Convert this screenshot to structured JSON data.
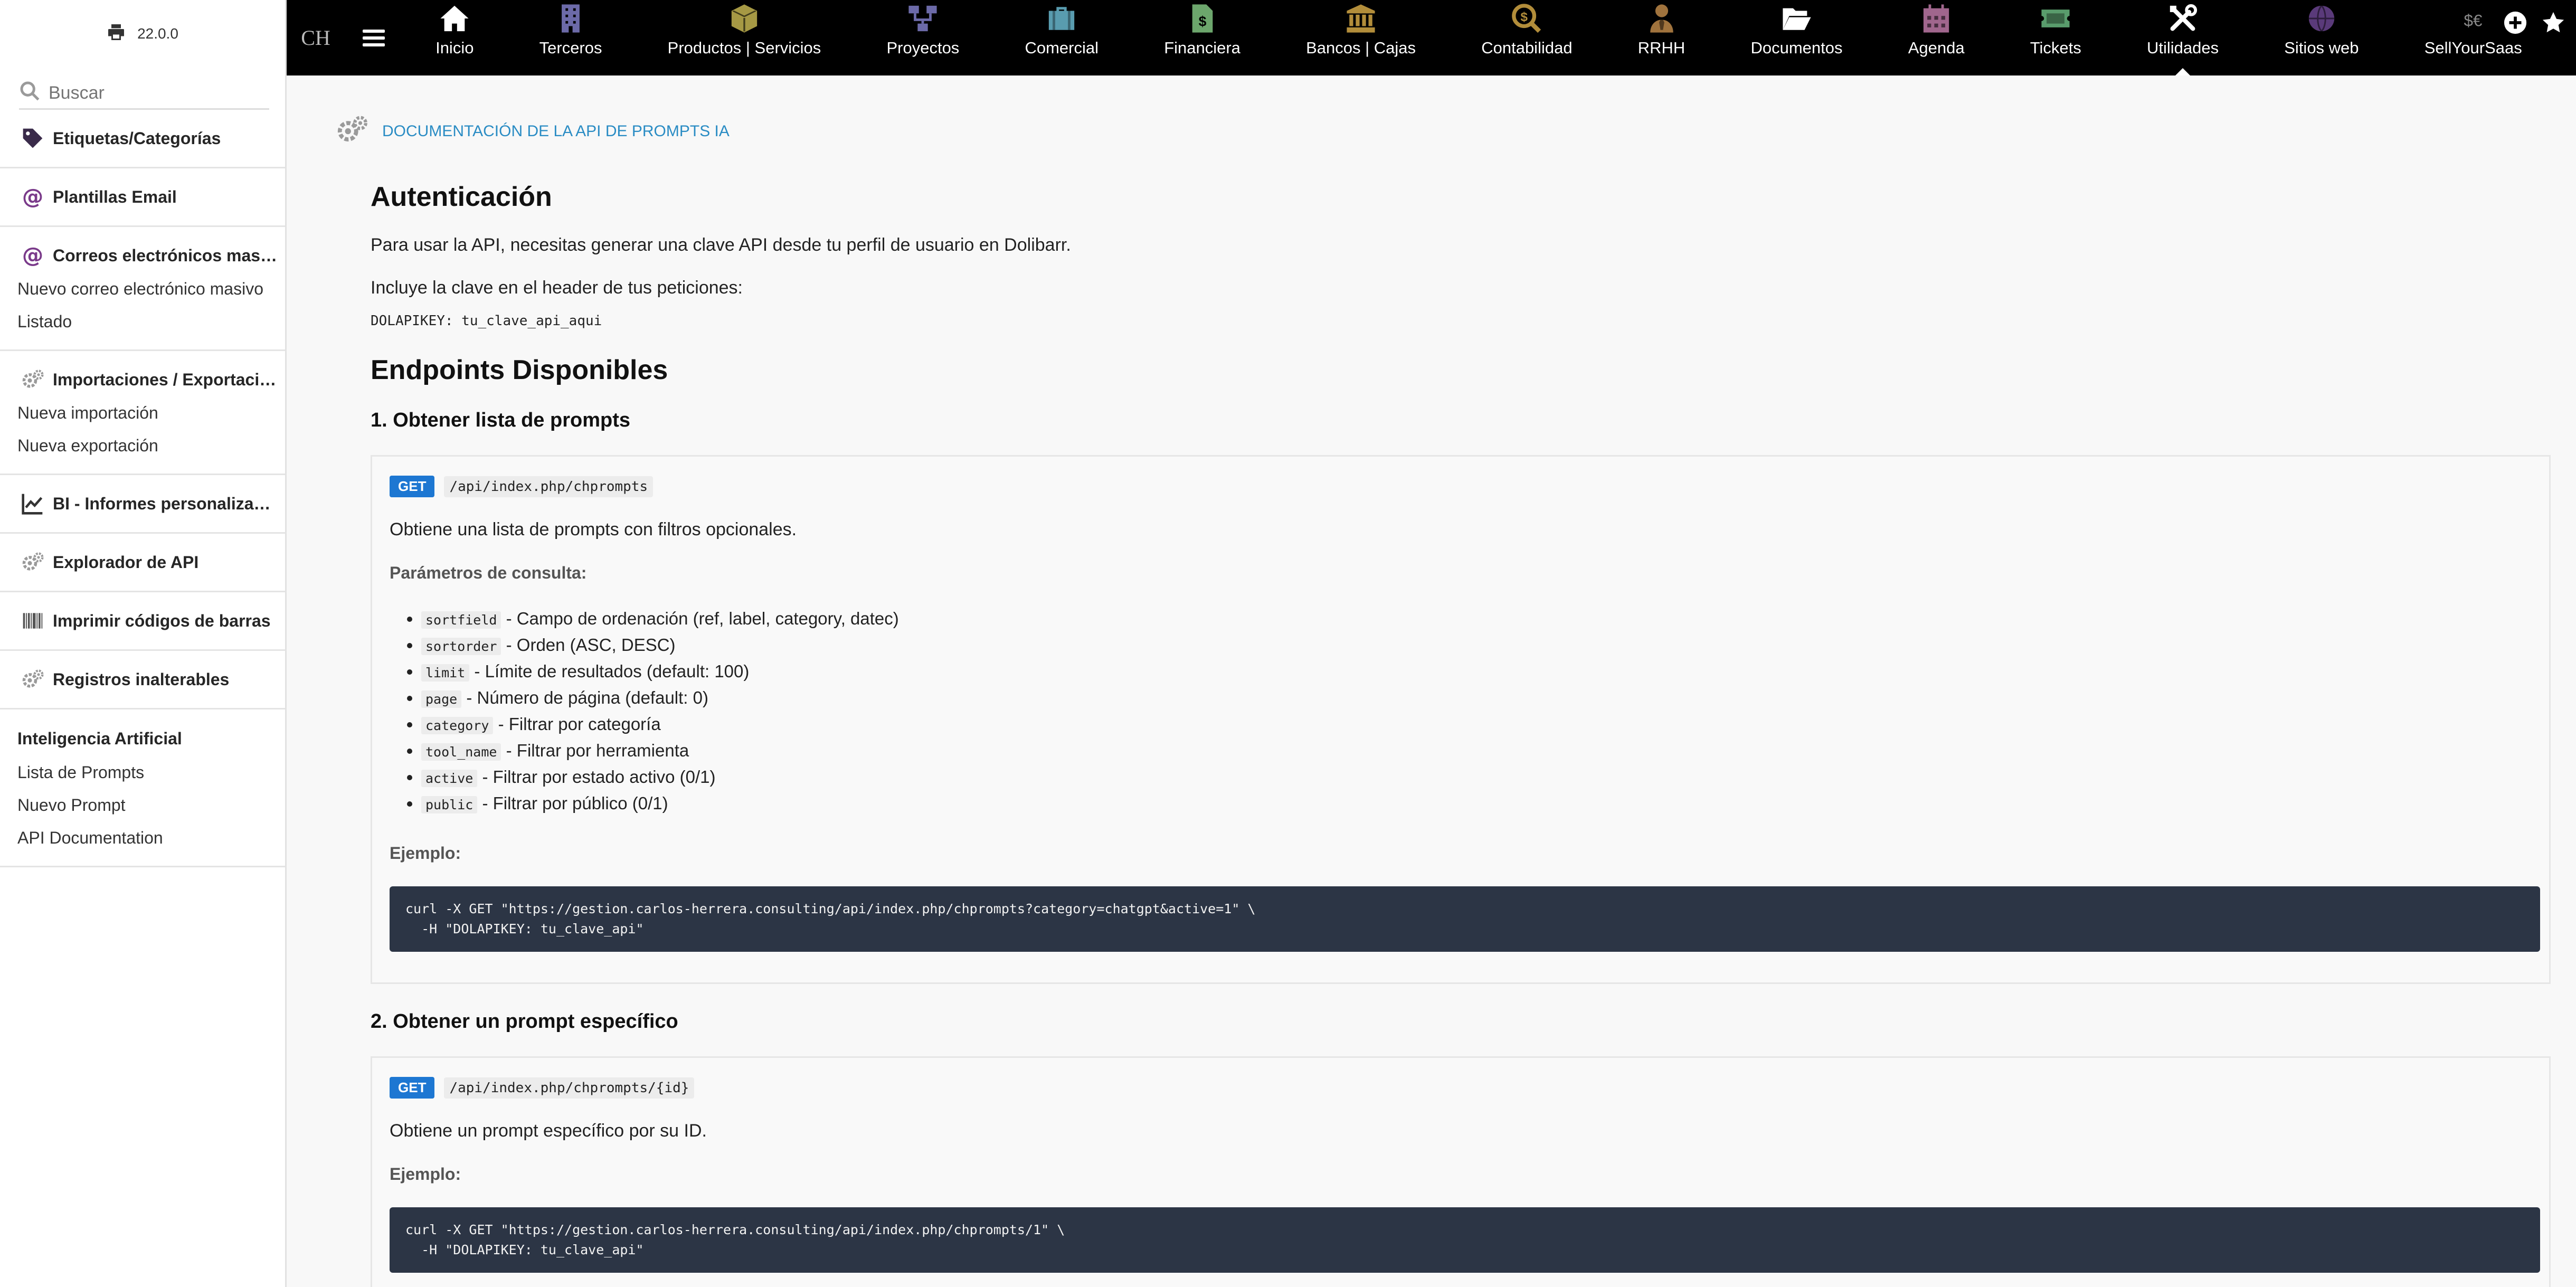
{
  "sidebar": {
    "version": "22.0.0",
    "search_placeholder": "Buscar",
    "blocks": [
      {
        "icon": "tag-icon",
        "title": "Etiquetas/Categorías",
        "items": []
      },
      {
        "icon": "at-icon",
        "title": "Plantillas Email",
        "items": []
      },
      {
        "icon": "at-icon",
        "title": "Correos electrónicos masivos",
        "items": [
          "Nuevo correo electrónico masivo",
          "Listado"
        ]
      },
      {
        "icon": "gears-icon",
        "title": "Importaciones / Exportaciones",
        "items": [
          "Nueva importación",
          "Nueva exportación"
        ]
      },
      {
        "icon": "chart-line-icon",
        "title": "BI - Informes personalizados",
        "items": []
      },
      {
        "icon": "gears-icon",
        "title": "Explorador de API",
        "items": []
      },
      {
        "icon": "barcode-icon",
        "title": "Imprimir códigos de barras",
        "items": []
      },
      {
        "icon": "gears-icon",
        "title": "Registros inalterables",
        "items": []
      }
    ],
    "ai_section": {
      "title": "Inteligencia Artificial",
      "items": [
        "Lista de Prompts",
        "Nuevo Prompt",
        "API Documentation"
      ]
    }
  },
  "topbar": {
    "logo": "CH",
    "items": [
      {
        "label": "Inicio",
        "icon": "home-icon",
        "color": "#ffffff"
      },
      {
        "label": "Terceros",
        "icon": "building-icon",
        "color": "#6c6aa8"
      },
      {
        "label": "Productos | Servicios",
        "icon": "box-icon",
        "color": "#a69944"
      },
      {
        "label": "Proyectos",
        "icon": "sitemap-icon",
        "color": "#6c6aa8"
      },
      {
        "label": "Comercial",
        "icon": "suitcase-icon",
        "color": "#599caf"
      },
      {
        "label": "Financiera",
        "icon": "invoice-icon",
        "color": "#6ca66c"
      },
      {
        "label": "Bancos | Cajas",
        "icon": "bank-icon",
        "color": "#b28d3a"
      },
      {
        "label": "Contabilidad",
        "icon": "accounting-icon",
        "color": "#b28d3a"
      },
      {
        "label": "RRHH",
        "icon": "user-tie-icon",
        "color": "#a0733d"
      },
      {
        "label": "Documentos",
        "icon": "folder-open-icon",
        "color": "#ffffff"
      },
      {
        "label": "Agenda",
        "icon": "calendar-icon",
        "color": "#a0668d"
      },
      {
        "label": "Tickets",
        "icon": "ticket-icon",
        "color": "#599c6c"
      },
      {
        "label": "Utilidades",
        "icon": "tools-icon",
        "color": "#ffffff",
        "active": true
      },
      {
        "label": "Sitios web",
        "icon": "globe-icon",
        "color": "#5a3a7a"
      },
      {
        "label": "SellYourSaas",
        "icon": "saas-icon",
        "color": "#ffffff"
      }
    ],
    "extra_icons": [
      "plus-circle-icon",
      "star-icon"
    ]
  },
  "main": {
    "page_title": "DOCUMENTACIÓN DE LA API DE PROMPTS IA",
    "auth": {
      "heading": "Autenticación",
      "p1": "Para usar la API, necesitas generar una clave API desde tu perfil de usuario en Dolibarr.",
      "p2": "Incluye la clave en el header de tus peticiones:",
      "code": "DOLAPIKEY: tu_clave_api_aqui"
    },
    "endpoints_heading": "Endpoints Disponibles",
    "endpoints": [
      {
        "title": "1. Obtener lista de prompts",
        "method": "GET",
        "path": "/api/index.php/chprompts",
        "description": "Obtiene una lista de prompts con filtros opcionales.",
        "params_label": "Parámetros de consulta:",
        "params": [
          {
            "name": "sortfield",
            "desc": " - Campo de ordenación (ref, label, category, datec)"
          },
          {
            "name": "sortorder",
            "desc": " - Orden (ASC, DESC)"
          },
          {
            "name": "limit",
            "desc": " - Límite de resultados (default: 100)"
          },
          {
            "name": "page",
            "desc": " - Número de página (default: 0)"
          },
          {
            "name": "category",
            "desc": " - Filtrar por categoría"
          },
          {
            "name": "tool_name",
            "desc": " - Filtrar por herramienta"
          },
          {
            "name": "active",
            "desc": " - Filtrar por estado activo (0/1)"
          },
          {
            "name": "public",
            "desc": " - Filtrar por público (0/1)"
          }
        ],
        "example_label": "Ejemplo:",
        "example": "curl -X GET \"https://gestion.carlos-herrera.consulting/api/index.php/chprompts?category=chatgpt&active=1\" \\\n  -H \"DOLAPIKEY: tu_clave_api\""
      },
      {
        "title": "2. Obtener un prompt específico",
        "method": "GET",
        "path": "/api/index.php/chprompts/{id}",
        "description": "Obtiene un prompt específico por su ID.",
        "example_label": "Ejemplo:",
        "example": "curl -X GET \"https://gestion.carlos-herrera.consulting/api/index.php/chprompts/1\" \\\n  -H \"DOLAPIKEY: tu_clave_api\""
      }
    ]
  }
}
